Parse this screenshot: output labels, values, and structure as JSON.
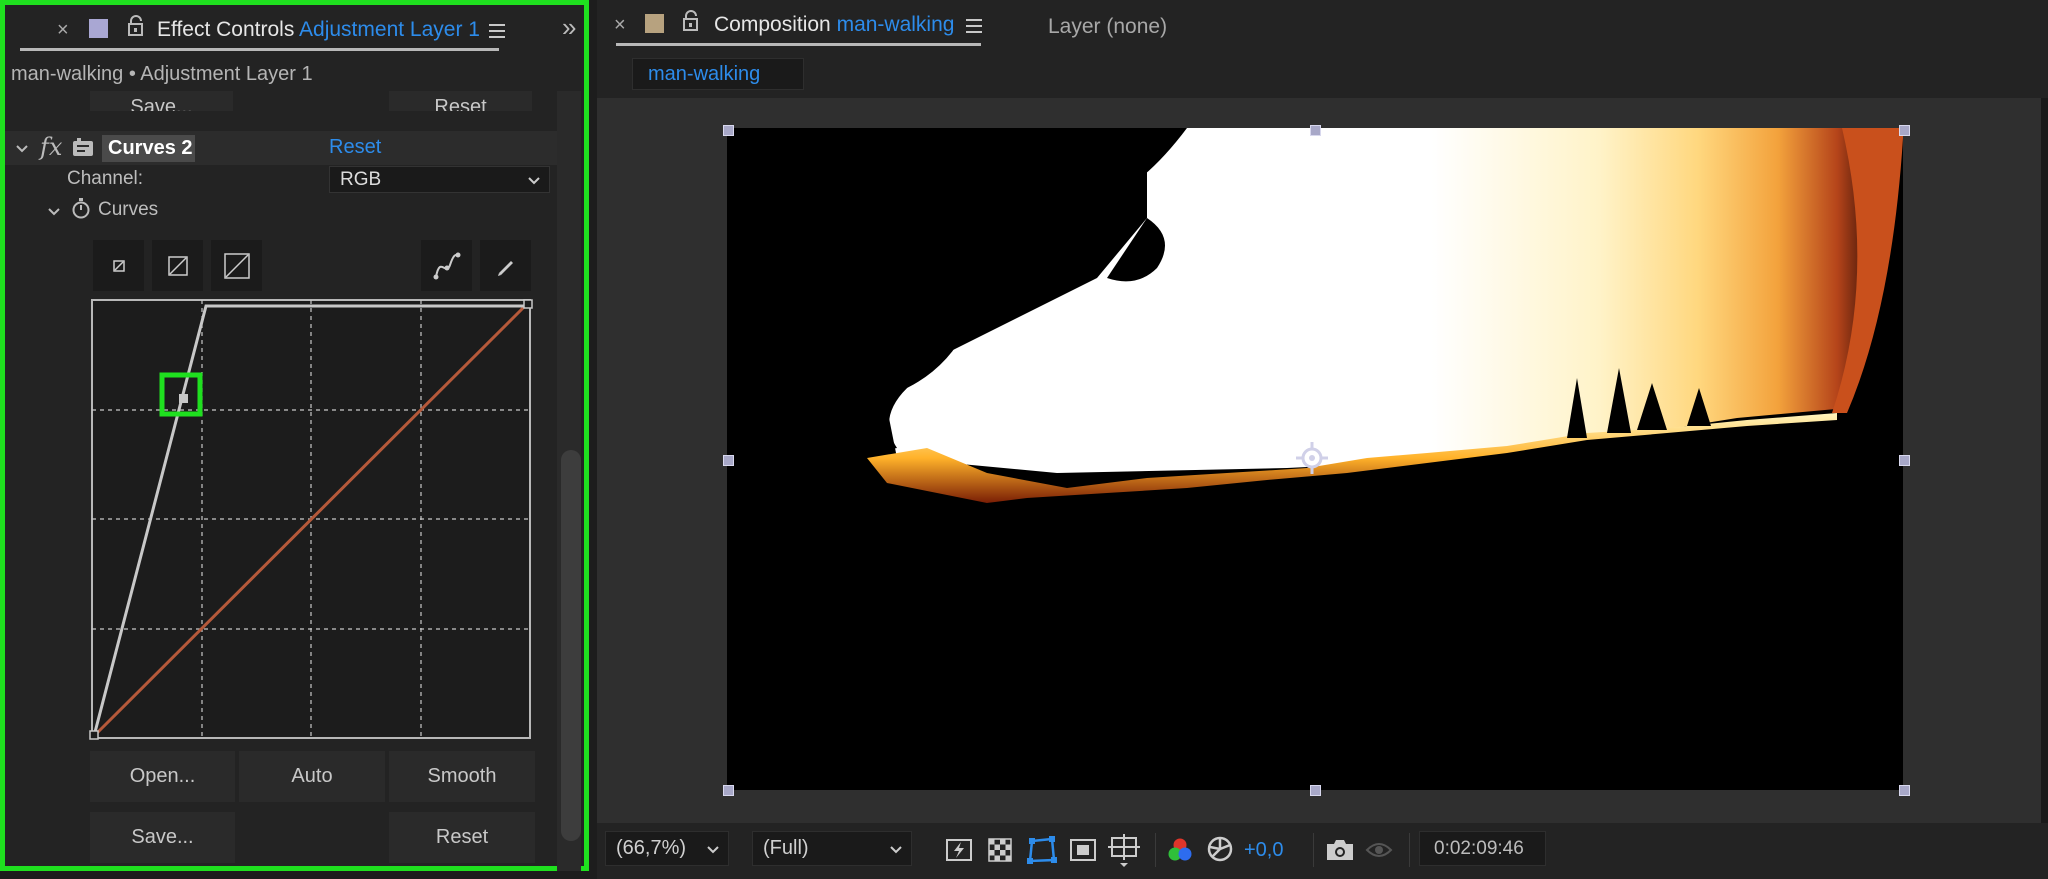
{
  "effect_controls": {
    "close_symbol": "×",
    "tab_title": "Effect Controls",
    "tab_layer": "Adjustment Layer 1",
    "expand_symbol": "»",
    "breadcrumb": "man-walking • Adjustment Layer 1",
    "prev_save_label": "Save...",
    "prev_reset_label": "Reset",
    "effect": {
      "fx_label": "fx",
      "name": "Curves 2",
      "reset_label": "Reset",
      "channel_label": "Channel:",
      "channel_value": "RGB",
      "curves_label": "Curves"
    },
    "curve_buttons": {
      "open": "Open...",
      "auto": "Auto",
      "smooth": "Smooth",
      "save": "Save...",
      "reset": "Reset"
    }
  },
  "composition": {
    "close_symbol": "×",
    "tab_title": "Composition",
    "tab_name": "man-walking",
    "layer_tab": "Layer (none)",
    "sub_tab": "man-walking",
    "magnification": "(66,7%)",
    "resolution": "(Full)",
    "exposure": "+0,0",
    "timecode": "0:02:09:46"
  },
  "colors": {
    "accent": "#2d8ceb",
    "highlight_border": "#1fe01f",
    "curve_rgb": "#b5593a",
    "curve_edit": "#c8c8c8"
  },
  "icons": [
    "close-icon",
    "color-swatch-icon",
    "lock-icon",
    "menu-icon",
    "expand-panels-icon",
    "disclosure-icon",
    "effect-type-icon",
    "stopwatch-icon",
    "histogram-icon",
    "pencil-icon",
    "bezier-icon",
    "camera-icon",
    "exposure-reset-icon",
    "target-icon"
  ]
}
